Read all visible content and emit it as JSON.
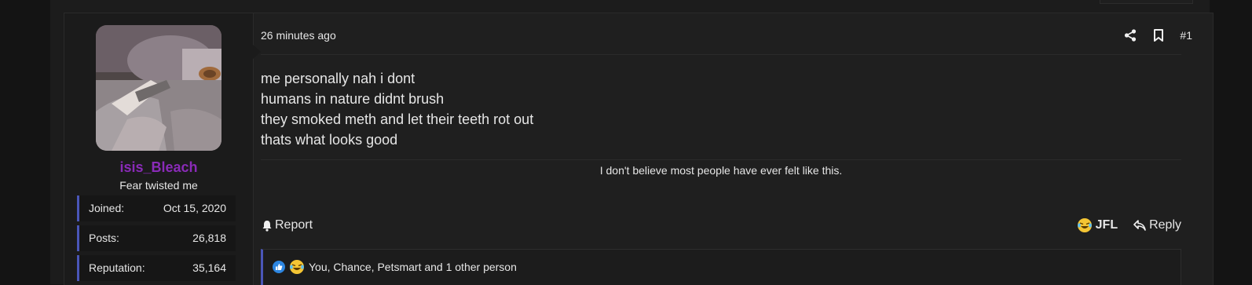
{
  "post": {
    "number": "#1",
    "time": "26 minutes ago",
    "body": [
      "me personally nah i dont",
      "humans in nature didnt brush",
      "they smoked meth and let their teeth rot out",
      "thats what looks good"
    ],
    "signature": "I don't believe most people have ever felt like this."
  },
  "user": {
    "name": "isis_Bleach",
    "title": "Fear twisted me",
    "stats": [
      {
        "label": "Joined:",
        "value": "Oct 15, 2020"
      },
      {
        "label": "Posts:",
        "value": "26,818"
      },
      {
        "label": "Reputation:",
        "value": "35,164"
      }
    ]
  },
  "actions": {
    "report": "Report",
    "react_label": "JFL",
    "reply": "Reply"
  },
  "reactions": {
    "text": "You, Chance, Petsmart and 1 other person"
  },
  "icons": {
    "share": "share-icon",
    "bookmark": "bookmark-icon",
    "bell": "bell-icon",
    "reply": "reply-icon",
    "like": "thumbs-up-icon",
    "laugh": "laughing-emoji-icon"
  },
  "colors": {
    "username": "#8a2bb8",
    "stat_accent": "#4a56b8",
    "like": "#2d86e0"
  }
}
